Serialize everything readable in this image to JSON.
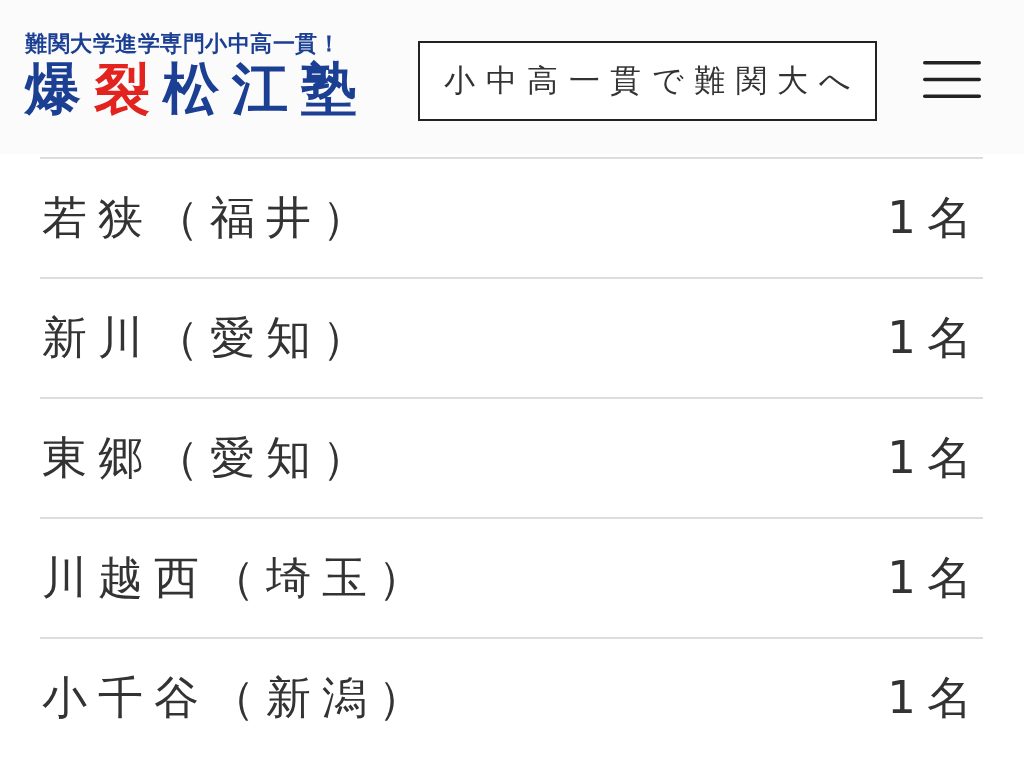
{
  "header": {
    "logo": {
      "tagline": "難関大学進学専門小中高一貫！",
      "title": [
        {
          "text": "爆",
          "color": "#1b3f93"
        },
        {
          "text": "裂",
          "color": "#e3231d"
        },
        {
          "text": "松江塾",
          "color": "#1b3f93"
        }
      ]
    },
    "cta_button": "小中高一貫で難関大へ"
  },
  "results": [
    {
      "school": "若狭（福井）",
      "count": "1名"
    },
    {
      "school": "新川（愛知）",
      "count": "1名"
    },
    {
      "school": "東郷（愛知）",
      "count": "1名"
    },
    {
      "school": "川越西（埼玉）",
      "count": "1名"
    },
    {
      "school": "小千谷（新潟）",
      "count": "1名"
    }
  ]
}
